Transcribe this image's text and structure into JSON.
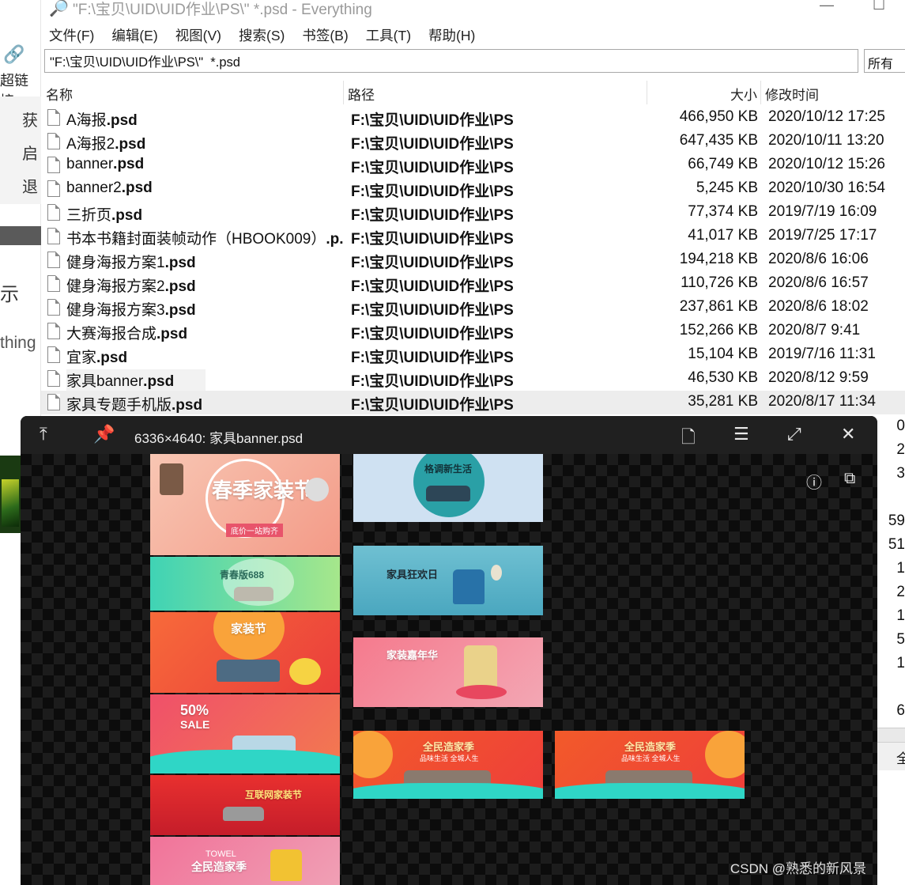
{
  "background_window": {
    "link_label": "超链接",
    "context_items": [
      "获",
      "启",
      "退"
    ],
    "side_char": "示",
    "side_text": "thing"
  },
  "everything": {
    "title": "\"F:\\宝贝\\UID\\UID作业\\PS\\\"  *.psd - Everything",
    "menu": [
      "文件(F)",
      "编辑(E)",
      "视图(V)",
      "搜索(S)",
      "书签(B)",
      "工具(T)",
      "帮助(H)"
    ],
    "search_value": "\"F:\\宝贝\\UID\\UID作业\\PS\\\"  *.psd",
    "filter_value": "所有",
    "columns": {
      "name": "名称",
      "path": "路径",
      "size": "大小",
      "modified": "修改时间"
    },
    "rows": [
      {
        "base": "A海报",
        "ext": ".psd",
        "path": "F:\\宝贝\\UID\\UID作业\\PS",
        "size": "466,950 KB",
        "date": "2020/10/12 17:25"
      },
      {
        "base": "A海报2",
        "ext": ".psd",
        "path": "F:\\宝贝\\UID\\UID作业\\PS",
        "size": "647,435 KB",
        "date": "2020/10/11 13:20"
      },
      {
        "base": "banner",
        "ext": ".psd",
        "path": "F:\\宝贝\\UID\\UID作业\\PS",
        "size": "66,749 KB",
        "date": "2020/10/12 15:26"
      },
      {
        "base": "banner2",
        "ext": ".psd",
        "path": "F:\\宝贝\\UID\\UID作业\\PS",
        "size": "5,245 KB",
        "date": "2020/10/30 16:54"
      },
      {
        "base": "三折页",
        "ext": ".psd",
        "path": "F:\\宝贝\\UID\\UID作业\\PS",
        "size": "77,374 KB",
        "date": "2019/7/19 16:09"
      },
      {
        "base": "书本书籍封面装帧动作（HBOOK009）",
        "ext": ".p...",
        "path": "F:\\宝贝\\UID\\UID作业\\PS",
        "size": "41,017 KB",
        "date": "2019/7/25 17:17"
      },
      {
        "base": "健身海报方案1",
        "ext": ".psd",
        "path": "F:\\宝贝\\UID\\UID作业\\PS",
        "size": "194,218 KB",
        "date": "2020/8/6 16:06"
      },
      {
        "base": "健身海报方案2",
        "ext": ".psd",
        "path": "F:\\宝贝\\UID\\UID作业\\PS",
        "size": "110,726 KB",
        "date": "2020/8/6 16:57"
      },
      {
        "base": "健身海报方案3",
        "ext": ".psd",
        "path": "F:\\宝贝\\UID\\UID作业\\PS",
        "size": "237,861 KB",
        "date": "2020/8/6 18:02"
      },
      {
        "base": "大赛海报合成",
        "ext": ".psd",
        "path": "F:\\宝贝\\UID\\UID作业\\PS",
        "size": "152,266 KB",
        "date": "2020/8/7 9:41"
      },
      {
        "base": "宜家",
        "ext": ".psd",
        "path": "F:\\宝贝\\UID\\UID作业\\PS",
        "size": "15,104 KB",
        "date": "2019/7/16 11:31"
      },
      {
        "base": "家具banner",
        "ext": ".psd",
        "path": "F:\\宝贝\\UID\\UID作业\\PS",
        "size": "46,530 KB",
        "date": "2020/8/12 9:59"
      },
      {
        "base": "家具专题手机版",
        "ext": ".psd",
        "path": "F:\\宝贝\\UID\\UID作业\\PS",
        "size": "35,281 KB",
        "date": "2020/8/17 11:34"
      }
    ],
    "peek_values": [
      "0",
      "2",
      "3",
      "59",
      "51",
      "1",
      "2",
      "1",
      "5",
      "1",
      "6"
    ],
    "peek_bottom": "全"
  },
  "preview": {
    "title": "6336×4640: 家具banner.psd",
    "banners": {
      "b1_title": "春季家装节",
      "b1_sub": "底价一站购齐",
      "b2_title": "青春版688",
      "b3_title": "家装节",
      "b4_title": "50%",
      "b4_sub": "SALE",
      "b5_title": "互联网家装节",
      "b6_title": "全民造家季",
      "b6_sub": "TOWEL",
      "b7_title": "格调新生活",
      "b8_title": "家具狂欢日",
      "b9_title": "家装嘉年华",
      "b10_title": "全民造家季",
      "b10_sub": "品味生活 全城人生",
      "b11_title": "全民造家季",
      "b11_sub": "品味生活 全城人生"
    }
  },
  "watermark": "CSDN @熟悉的新风景"
}
